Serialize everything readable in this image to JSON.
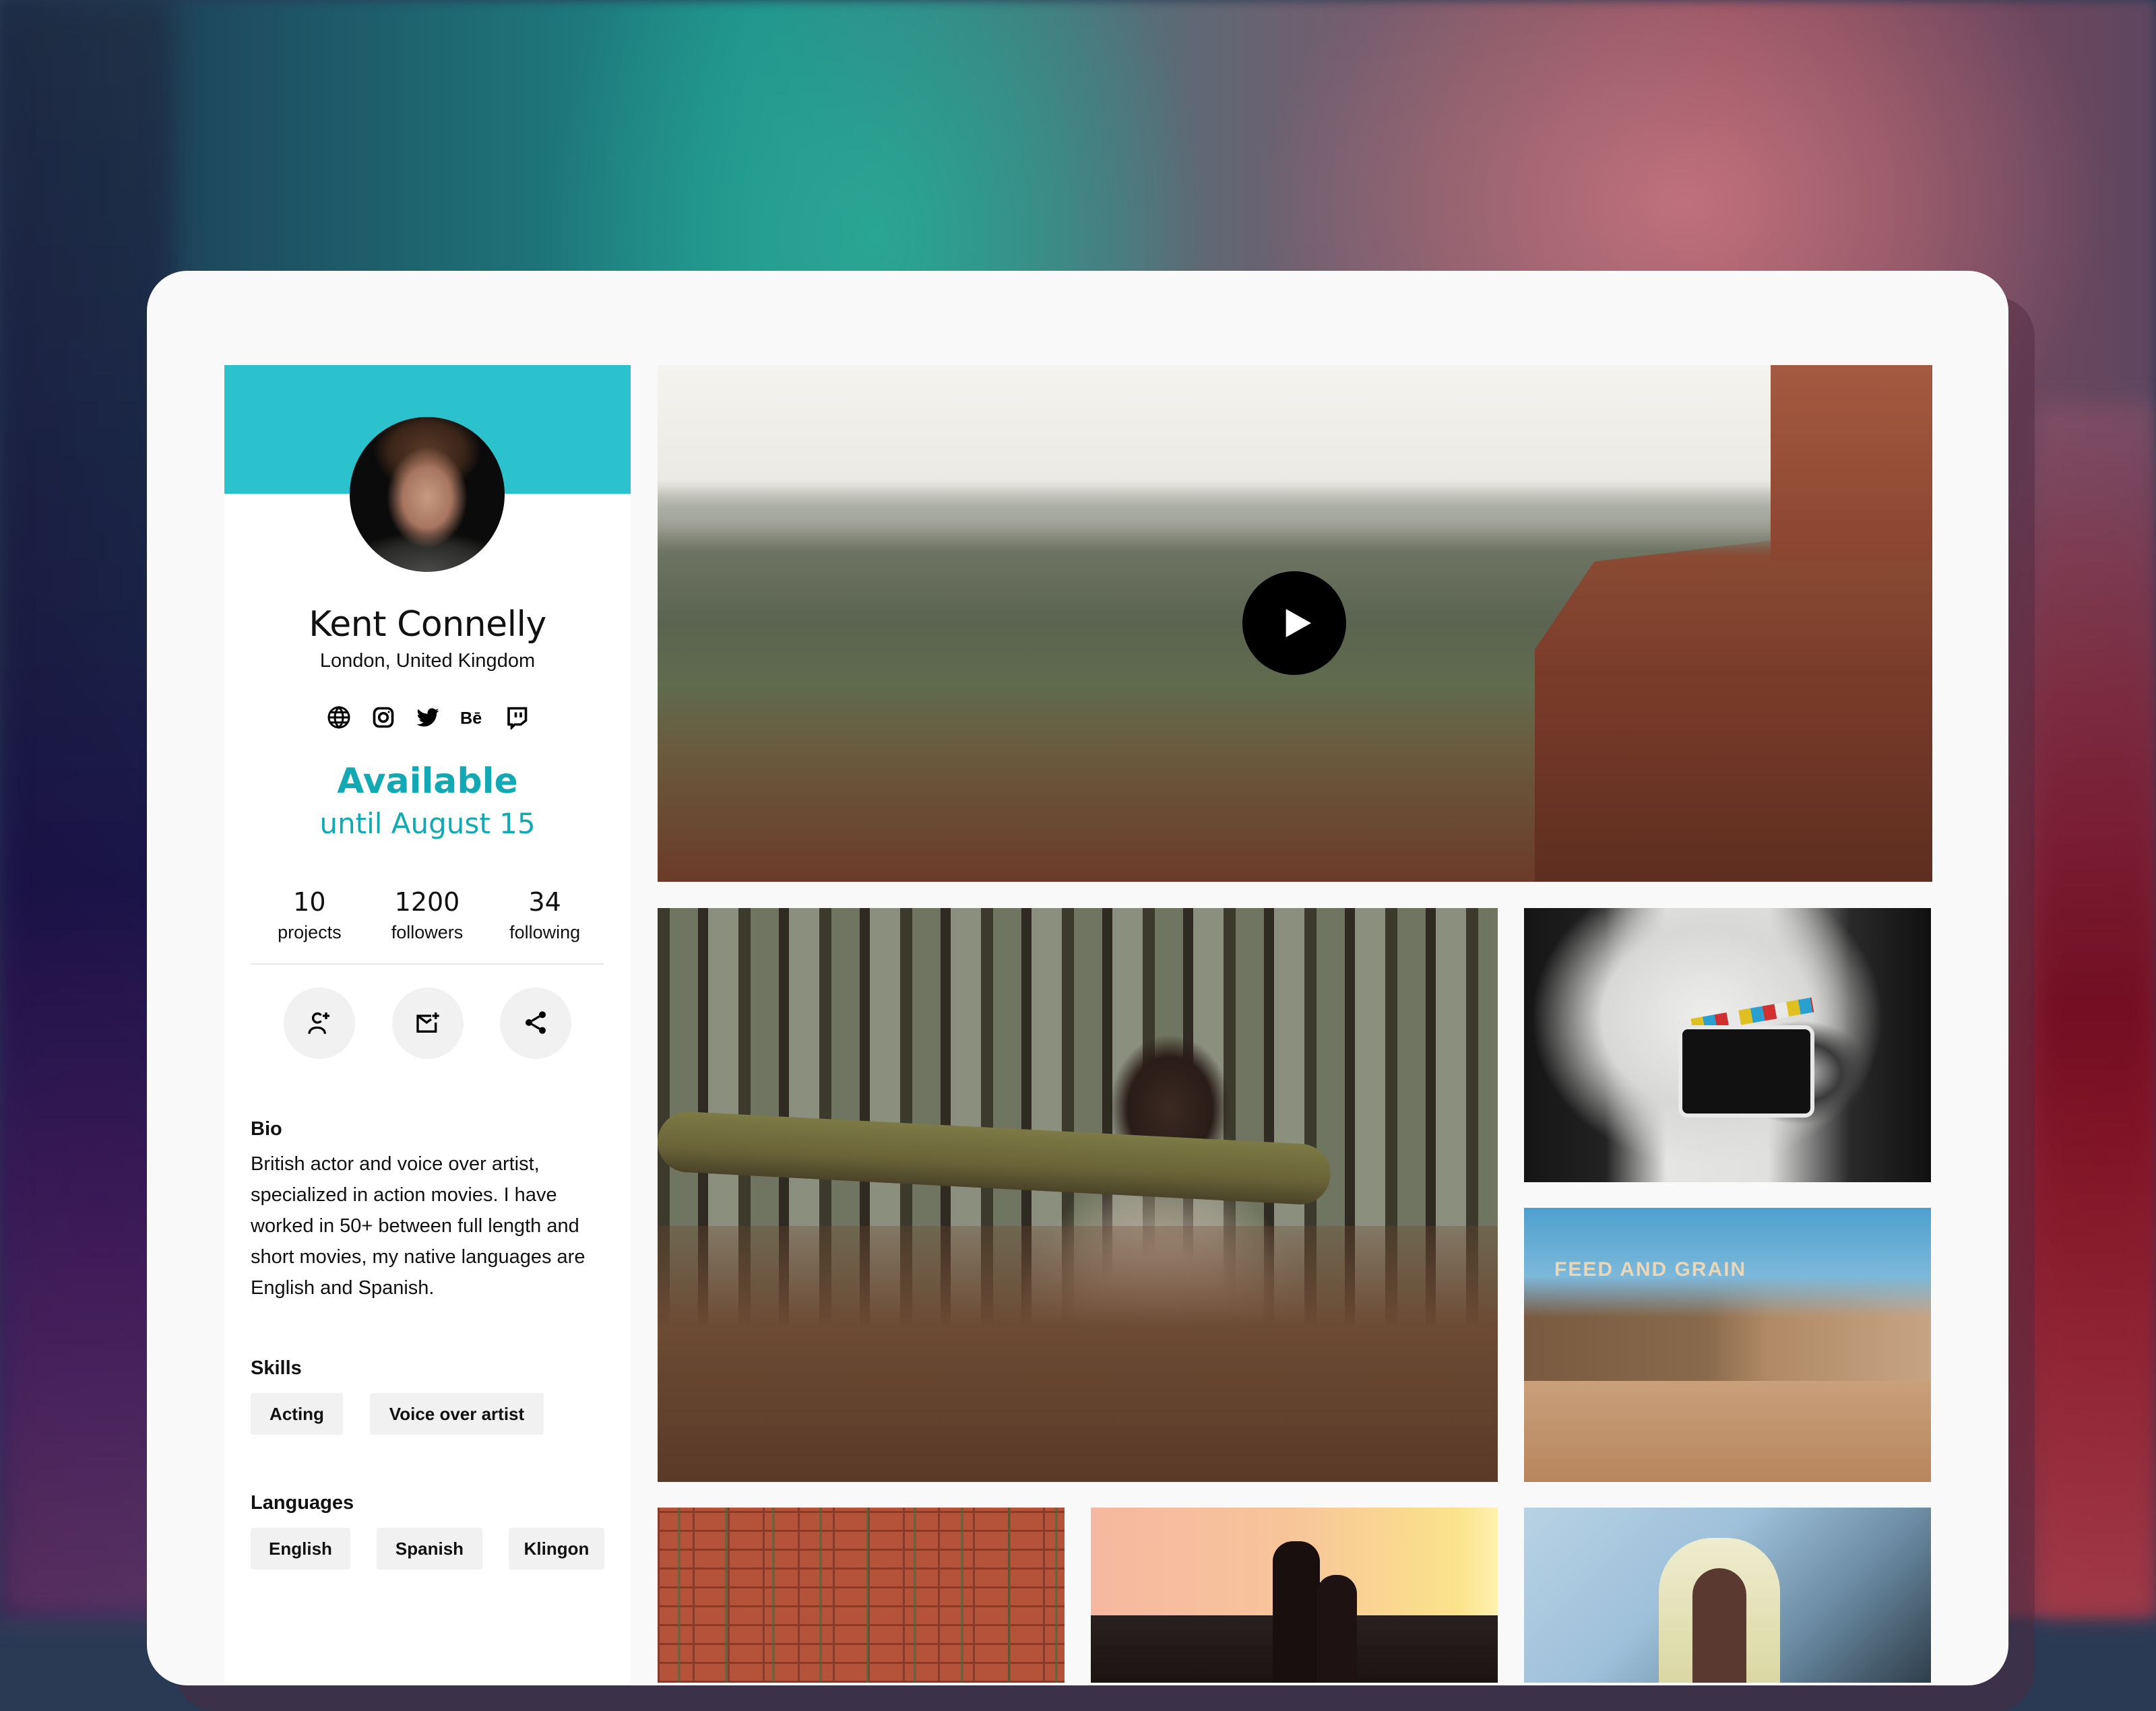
{
  "profile": {
    "name": "Kent Connelly",
    "location": "London, United Kingdom",
    "avatar": "profile-photo",
    "social_links": [
      {
        "icon": "globe-icon",
        "label": "Website"
      },
      {
        "icon": "instagram-icon",
        "label": "Instagram"
      },
      {
        "icon": "twitter-icon",
        "label": "Twitter"
      },
      {
        "icon": "behance-icon",
        "label": "Behance"
      },
      {
        "icon": "twitch-icon",
        "label": "Twitch"
      }
    ],
    "availability": {
      "status": "Available",
      "until": "until August 15",
      "color": "#13a9b4"
    },
    "stats": [
      {
        "value": "10",
        "label": "projects"
      },
      {
        "value": "1200",
        "label": "followers"
      },
      {
        "value": "34",
        "label": "following"
      }
    ],
    "actions": [
      {
        "icon": "follow-user-icon",
        "label": "Follow"
      },
      {
        "icon": "add-message-icon",
        "label": "Message"
      },
      {
        "icon": "share-icon",
        "label": "Share"
      }
    ],
    "bio": {
      "heading": "Bio",
      "text": "British actor and voice over artist, specialized in action movies. I have worked in 50+ between full length and short movies, my native languages are English and Spanish."
    },
    "skills": {
      "heading": "Skills",
      "items": [
        "Acting",
        "Voice over artist"
      ]
    },
    "languages": {
      "heading": "Languages",
      "items": [
        "English",
        "Spanish",
        "Klingon"
      ]
    },
    "header_color": "#2bc1cd"
  },
  "gallery": {
    "items": [
      {
        "id": "hero-video",
        "type": "video",
        "description": "Man standing on red rock cliff overlooking valley",
        "play_icon": "play-icon"
      },
      {
        "id": "forest",
        "type": "image",
        "description": "Man carrying log in forest"
      },
      {
        "id": "clapper",
        "type": "image",
        "description": "Film clapperboard on set"
      },
      {
        "id": "western-set",
        "type": "image",
        "description": "Film crew on western town set",
        "sign_text": "FEED AND GRAIN"
      },
      {
        "id": "brick-wall",
        "type": "image",
        "description": "Ivy on red brick wall"
      },
      {
        "id": "sunset",
        "type": "image",
        "description": "Couple silhouette at sunset"
      },
      {
        "id": "hooded-figure",
        "type": "image",
        "description": "Person in yellow hood"
      }
    ]
  }
}
